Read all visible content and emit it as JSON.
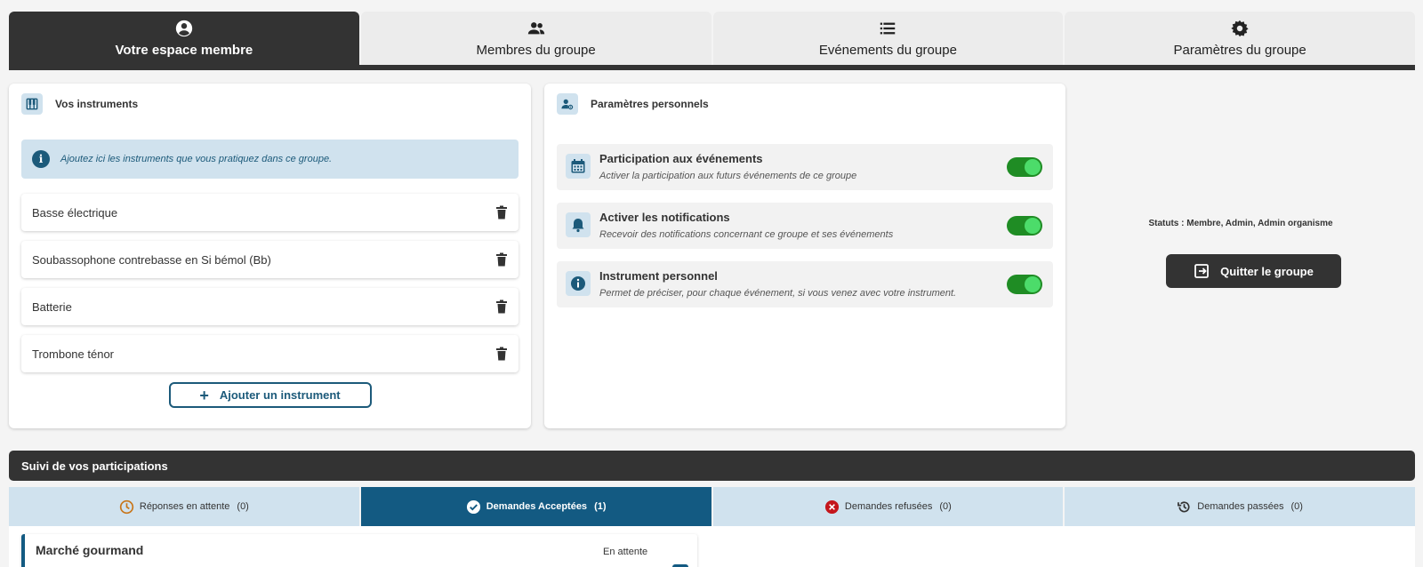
{
  "top_tabs": [
    {
      "label": "Votre espace membre",
      "icon": "account-circle-icon"
    },
    {
      "label": "Membres du groupe",
      "icon": "group-icon"
    },
    {
      "label": "Evénements du groupe",
      "icon": "list-icon"
    },
    {
      "label": "Paramètres du groupe",
      "icon": "gear-icon"
    }
  ],
  "instruments": {
    "title": "Vos instruments",
    "info": "Ajoutez ici les instruments que vous pratiquez dans ce groupe.",
    "items": [
      "Basse électrique",
      "Soubassophone contrebasse en Si bémol (Bb)",
      "Batterie",
      "Trombone ténor"
    ],
    "add_label": "Ajouter un instrument"
  },
  "personal": {
    "title": "Paramètres personnels",
    "settings": [
      {
        "title": "Participation aux événements",
        "desc": "Activer la participation aux futurs événements de ce groupe",
        "on": true,
        "icon": "calendar-icon"
      },
      {
        "title": "Activer les notifications",
        "desc": "Recevoir des notifications concernant ce groupe et ses événements",
        "on": true,
        "icon": "bell-icon"
      },
      {
        "title": "Instrument personnel",
        "desc": "Permet de préciser, pour chaque événement, si vous venez avec votre instrument.",
        "on": true,
        "icon": "info-icon"
      }
    ]
  },
  "status_text": "Statuts : Membre,  Admin,  Admin organisme",
  "quit_label": "Quitter le groupe",
  "suivi_title": "Suivi de vos participations",
  "sub_tabs": [
    {
      "label": "Réponses en attente",
      "count": "(0)",
      "icon": "clock-icon"
    },
    {
      "label": "Demandes Acceptées",
      "count": "(1)",
      "icon": "check-circle-icon"
    },
    {
      "label": "Demandes refusées",
      "count": "(0)",
      "icon": "cancel-icon"
    },
    {
      "label": "Demandes passées",
      "count": "(0)",
      "icon": "history-icon"
    }
  ],
  "event": {
    "title": "Marché gourmand",
    "status": "En attente"
  },
  "colors": {
    "accent": "#135a82",
    "dark": "#333333",
    "toggle": "#1f8c24"
  }
}
